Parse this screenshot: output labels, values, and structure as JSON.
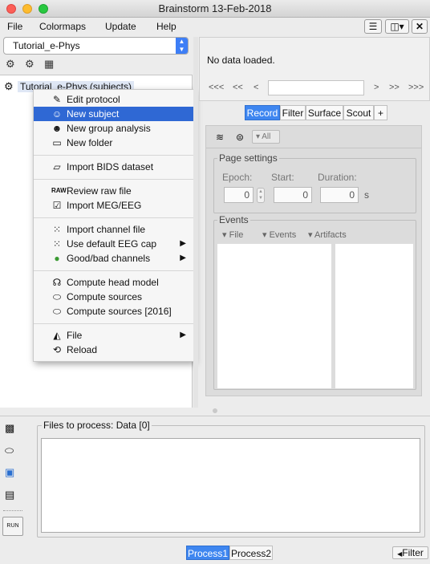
{
  "window": {
    "title": "Brainstorm 13-Feb-2018"
  },
  "menubar": {
    "items": [
      "File",
      "Colormaps",
      "Update",
      "Help"
    ]
  },
  "protocol": {
    "selected": "Tutorial_e-Phys"
  },
  "tree": {
    "root_label": "Tutorial_e-Phys (subjects)"
  },
  "context_menu": {
    "items": [
      {
        "label": "Edit protocol",
        "icon": "edit-icon"
      },
      {
        "label": "New subject",
        "icon": "subject-icon"
      },
      {
        "label": "New group analysis",
        "icon": "group-icon"
      },
      {
        "label": "New folder",
        "icon": "folder-icon"
      },
      {
        "label": "Import BIDS dataset",
        "icon": "folder-open-icon"
      },
      {
        "label": "Review raw file",
        "icon": "raw-icon"
      },
      {
        "label": "Import MEG/EEG",
        "icon": "import-icon"
      },
      {
        "label": "Import channel file",
        "icon": "channel-icon"
      },
      {
        "label": "Use default EEG cap",
        "icon": "cap-icon"
      },
      {
        "label": "Good/bad channels",
        "icon": "goodbad-icon"
      },
      {
        "label": "Compute head model",
        "icon": "head-icon"
      },
      {
        "label": "Compute sources",
        "icon": "brain-icon"
      },
      {
        "label": "Compute sources [2016]",
        "icon": "brain-icon"
      },
      {
        "label": "File",
        "icon": "file-icon"
      },
      {
        "label": "Reload",
        "icon": "reload-icon"
      }
    ]
  },
  "viewer": {
    "status": "No data loaded.",
    "nav": [
      "<<<",
      "<<",
      "<",
      ">",
      ">>",
      ">>>"
    ]
  },
  "tabs": [
    "Record",
    "Filter",
    "Surface",
    "Scout",
    "+"
  ],
  "record": {
    "all_label": "All",
    "page_settings": {
      "title": "Page settings",
      "epoch_label": "Epoch:",
      "start_label": "Start:",
      "duration_label": "Duration:",
      "epoch_value": "0",
      "start_value": "0",
      "duration_value": "0",
      "unit": "s"
    },
    "events": {
      "title": "Events",
      "menus": [
        "File",
        "Events",
        "Artifacts"
      ]
    }
  },
  "process": {
    "title": "Files to process: Data [0]",
    "run_label": "RUN",
    "tabs": [
      "Process1",
      "Process2"
    ],
    "filter_label": "Filter"
  },
  "colors": {
    "accent": "#2f68d4",
    "tab_active": "#3e86f0"
  }
}
